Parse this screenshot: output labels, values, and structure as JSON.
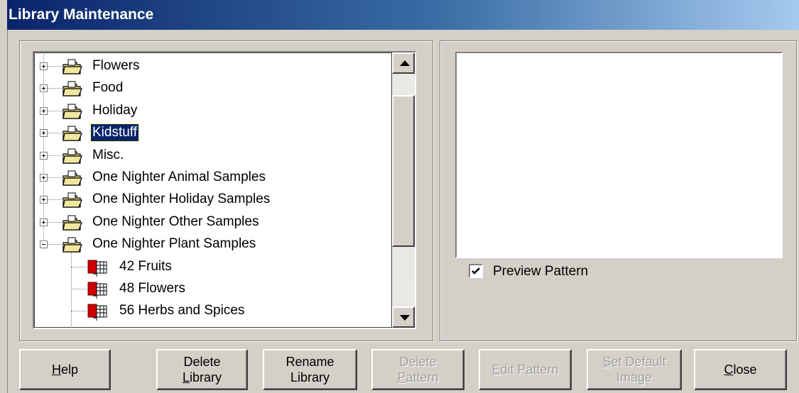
{
  "window": {
    "title": "Library Maintenance"
  },
  "tree": {
    "categories": [
      {
        "label": "Flowers",
        "expanded": false
      },
      {
        "label": "Food",
        "expanded": false
      },
      {
        "label": "Holiday",
        "expanded": false
      },
      {
        "label": "Kidstuff",
        "expanded": false,
        "selected": true
      },
      {
        "label": "Misc.",
        "expanded": false
      },
      {
        "label": "One Nighter Animal Samples",
        "expanded": false
      },
      {
        "label": "One Nighter Holiday Samples",
        "expanded": false
      },
      {
        "label": "One Nighter Other Samples",
        "expanded": false
      },
      {
        "label": "One Nighter Plant Samples",
        "expanded": true
      }
    ],
    "patterns": [
      {
        "label": "42 Fruits"
      },
      {
        "label": "48 Flowers"
      },
      {
        "label": "56 Herbs and Spices"
      }
    ]
  },
  "preview": {
    "checkbox_label": "Preview Pattern",
    "checked": true
  },
  "buttons": {
    "help": {
      "l1_pre": "",
      "l1_u": "H",
      "l1_post": "elp",
      "enabled": true
    },
    "delete_library": {
      "line1": "Delete",
      "l2_u": "L",
      "l2_post": "ibrary",
      "enabled": true
    },
    "rename_library": {
      "line1": "Rename",
      "line2": "Library",
      "enabled": true
    },
    "delete_pattern": {
      "line1": "Delete",
      "l2_u": "P",
      "l2_post": "attern",
      "enabled": false
    },
    "edit_pattern": {
      "l1_u": "E",
      "l1_post": "dit Pattern",
      "enabled": false
    },
    "set_default_image": {
      "l1_u": "S",
      "l1_post": "et Default",
      "line2": "Image",
      "enabled": false
    },
    "close": {
      "l1_u": "C",
      "l1_post": "lose",
      "enabled": true
    }
  }
}
